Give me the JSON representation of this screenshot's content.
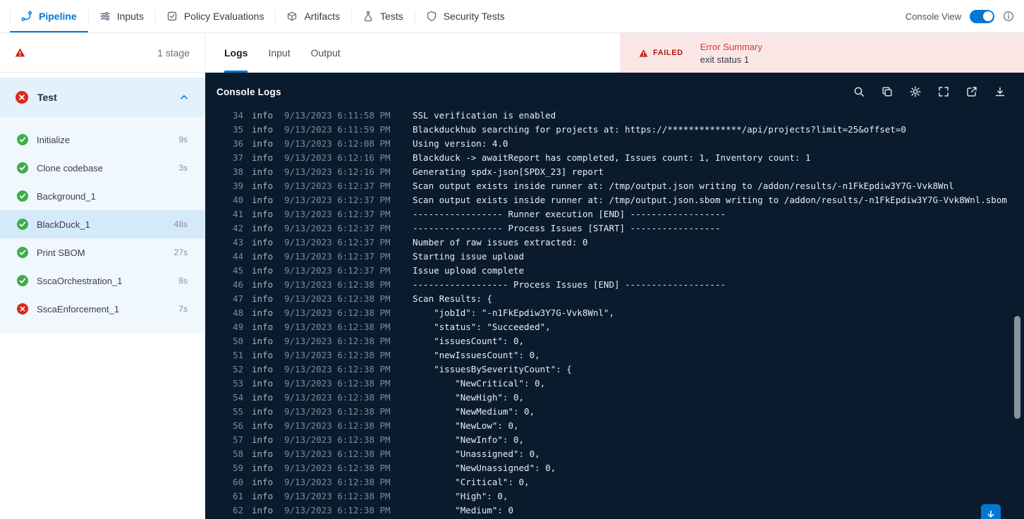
{
  "colors": {
    "accent_blue": "#0278d5",
    "error_red": "#b41710",
    "error_bg": "#fbe6e6",
    "console_bg": "#0a1b2e",
    "success_green": "#3fae49",
    "fail_red": "#da291d"
  },
  "nav": {
    "tabs": [
      {
        "label": "Pipeline",
        "icon": "pipeline-icon",
        "active": true
      },
      {
        "label": "Inputs",
        "icon": "inputs-icon",
        "active": false
      },
      {
        "label": "Policy Evaluations",
        "icon": "policy-evaluations-icon",
        "active": false
      },
      {
        "label": "Artifacts",
        "icon": "artifacts-icon",
        "active": false
      },
      {
        "label": "Tests",
        "icon": "tests-icon",
        "active": false
      },
      {
        "label": "Security Tests",
        "icon": "security-tests-icon",
        "active": false
      }
    ],
    "console_view_label": "Console View",
    "console_view_on": true
  },
  "sidebar": {
    "stage_count_label": "1 stage",
    "group": {
      "label": "Test",
      "status": "failed"
    },
    "steps": [
      {
        "label": "Initialize",
        "duration": "9s",
        "status": "success",
        "selected": false
      },
      {
        "label": "Clone codebase",
        "duration": "3s",
        "status": "success",
        "selected": false
      },
      {
        "label": "Background_1",
        "duration": "",
        "status": "success",
        "selected": false
      },
      {
        "label": "BlackDuck_1",
        "duration": "48s",
        "status": "success",
        "selected": true
      },
      {
        "label": "Print SBOM",
        "duration": "27s",
        "status": "success",
        "selected": false
      },
      {
        "label": "SscaOrchestration_1",
        "duration": "8s",
        "status": "success",
        "selected": false
      },
      {
        "label": "SscaEnforcement_1",
        "duration": "7s",
        "status": "failed",
        "selected": false
      }
    ]
  },
  "main": {
    "tabs": [
      {
        "label": "Logs",
        "active": true
      },
      {
        "label": "Input",
        "active": false
      },
      {
        "label": "Output",
        "active": false
      }
    ],
    "error_summary": {
      "badge": "FAILED",
      "title": "Error Summary",
      "message": "exit status 1"
    },
    "console": {
      "title": "Console Logs",
      "toolbar_icons": [
        "search-icon",
        "copy-icon",
        "gear-icon",
        "fullscreen-icon",
        "external-link-icon",
        "download-icon"
      ],
      "logs": [
        {
          "n": 34,
          "level": "info",
          "time": "9/13/2023 6:11:58 PM",
          "msg": "SSL verification is enabled"
        },
        {
          "n": 35,
          "level": "info",
          "time": "9/13/2023 6:11:59 PM",
          "msg": "Blackduckhub searching for projects at: https://**************/api/projects?limit=25&offset=0"
        },
        {
          "n": 36,
          "level": "info",
          "time": "9/13/2023 6:12:08 PM",
          "msg": "Using version: 4.0"
        },
        {
          "n": 37,
          "level": "info",
          "time": "9/13/2023 6:12:16 PM",
          "msg": "Blackduck -> awaitReport has completed, Issues count: 1, Inventory count: 1"
        },
        {
          "n": 38,
          "level": "info",
          "time": "9/13/2023 6:12:16 PM",
          "msg": "Generating spdx-json[SPDX_23] report"
        },
        {
          "n": 39,
          "level": "info",
          "time": "9/13/2023 6:12:37 PM",
          "msg": "Scan output exists inside runner at: /tmp/output.json writing to /addon/results/-n1FkEpdiw3Y7G-Vvk8Wnl"
        },
        {
          "n": 40,
          "level": "info",
          "time": "9/13/2023 6:12:37 PM",
          "msg": "Scan output exists inside runner at: /tmp/output.json.sbom writing to /addon/results/-n1FkEpdiw3Y7G-Vvk8Wnl.sbom"
        },
        {
          "n": 41,
          "level": "info",
          "time": "9/13/2023 6:12:37 PM",
          "msg": "----------------- Runner execution [END] ------------------"
        },
        {
          "n": 42,
          "level": "info",
          "time": "9/13/2023 6:12:37 PM",
          "msg": "----------------- Process Issues [START] -----------------"
        },
        {
          "n": 43,
          "level": "info",
          "time": "9/13/2023 6:12:37 PM",
          "msg": "Number of raw issues extracted: 0"
        },
        {
          "n": 44,
          "level": "info",
          "time": "9/13/2023 6:12:37 PM",
          "msg": "Starting issue upload"
        },
        {
          "n": 45,
          "level": "info",
          "time": "9/13/2023 6:12:37 PM",
          "msg": "Issue upload complete"
        },
        {
          "n": 46,
          "level": "info",
          "time": "9/13/2023 6:12:38 PM",
          "msg": "------------------ Process Issues [END] -------------------"
        },
        {
          "n": 47,
          "level": "info",
          "time": "9/13/2023 6:12:38 PM",
          "msg": "Scan Results: {"
        },
        {
          "n": 48,
          "level": "info",
          "time": "9/13/2023 6:12:38 PM",
          "msg": "    \"jobId\": \"-n1FkEpdiw3Y7G-Vvk8Wnl\","
        },
        {
          "n": 49,
          "level": "info",
          "time": "9/13/2023 6:12:38 PM",
          "msg": "    \"status\": \"Succeeded\","
        },
        {
          "n": 50,
          "level": "info",
          "time": "9/13/2023 6:12:38 PM",
          "msg": "    \"issuesCount\": 0,"
        },
        {
          "n": 51,
          "level": "info",
          "time": "9/13/2023 6:12:38 PM",
          "msg": "    \"newIssuesCount\": 0,"
        },
        {
          "n": 52,
          "level": "info",
          "time": "9/13/2023 6:12:38 PM",
          "msg": "    \"issuesBySeverityCount\": {"
        },
        {
          "n": 53,
          "level": "info",
          "time": "9/13/2023 6:12:38 PM",
          "msg": "        \"NewCritical\": 0,"
        },
        {
          "n": 54,
          "level": "info",
          "time": "9/13/2023 6:12:38 PM",
          "msg": "        \"NewHigh\": 0,"
        },
        {
          "n": 55,
          "level": "info",
          "time": "9/13/2023 6:12:38 PM",
          "msg": "        \"NewMedium\": 0,"
        },
        {
          "n": 56,
          "level": "info",
          "time": "9/13/2023 6:12:38 PM",
          "msg": "        \"NewLow\": 0,"
        },
        {
          "n": 57,
          "level": "info",
          "time": "9/13/2023 6:12:38 PM",
          "msg": "        \"NewInfo\": 0,"
        },
        {
          "n": 58,
          "level": "info",
          "time": "9/13/2023 6:12:38 PM",
          "msg": "        \"Unassigned\": 0,"
        },
        {
          "n": 59,
          "level": "info",
          "time": "9/13/2023 6:12:38 PM",
          "msg": "        \"NewUnassigned\": 0,"
        },
        {
          "n": 60,
          "level": "info",
          "time": "9/13/2023 6:12:38 PM",
          "msg": "        \"Critical\": 0,"
        },
        {
          "n": 61,
          "level": "info",
          "time": "9/13/2023 6:12:38 PM",
          "msg": "        \"High\": 0,"
        },
        {
          "n": 62,
          "level": "info",
          "time": "9/13/2023 6:12:38 PM",
          "msg": "        \"Medium\": 0"
        }
      ]
    }
  }
}
